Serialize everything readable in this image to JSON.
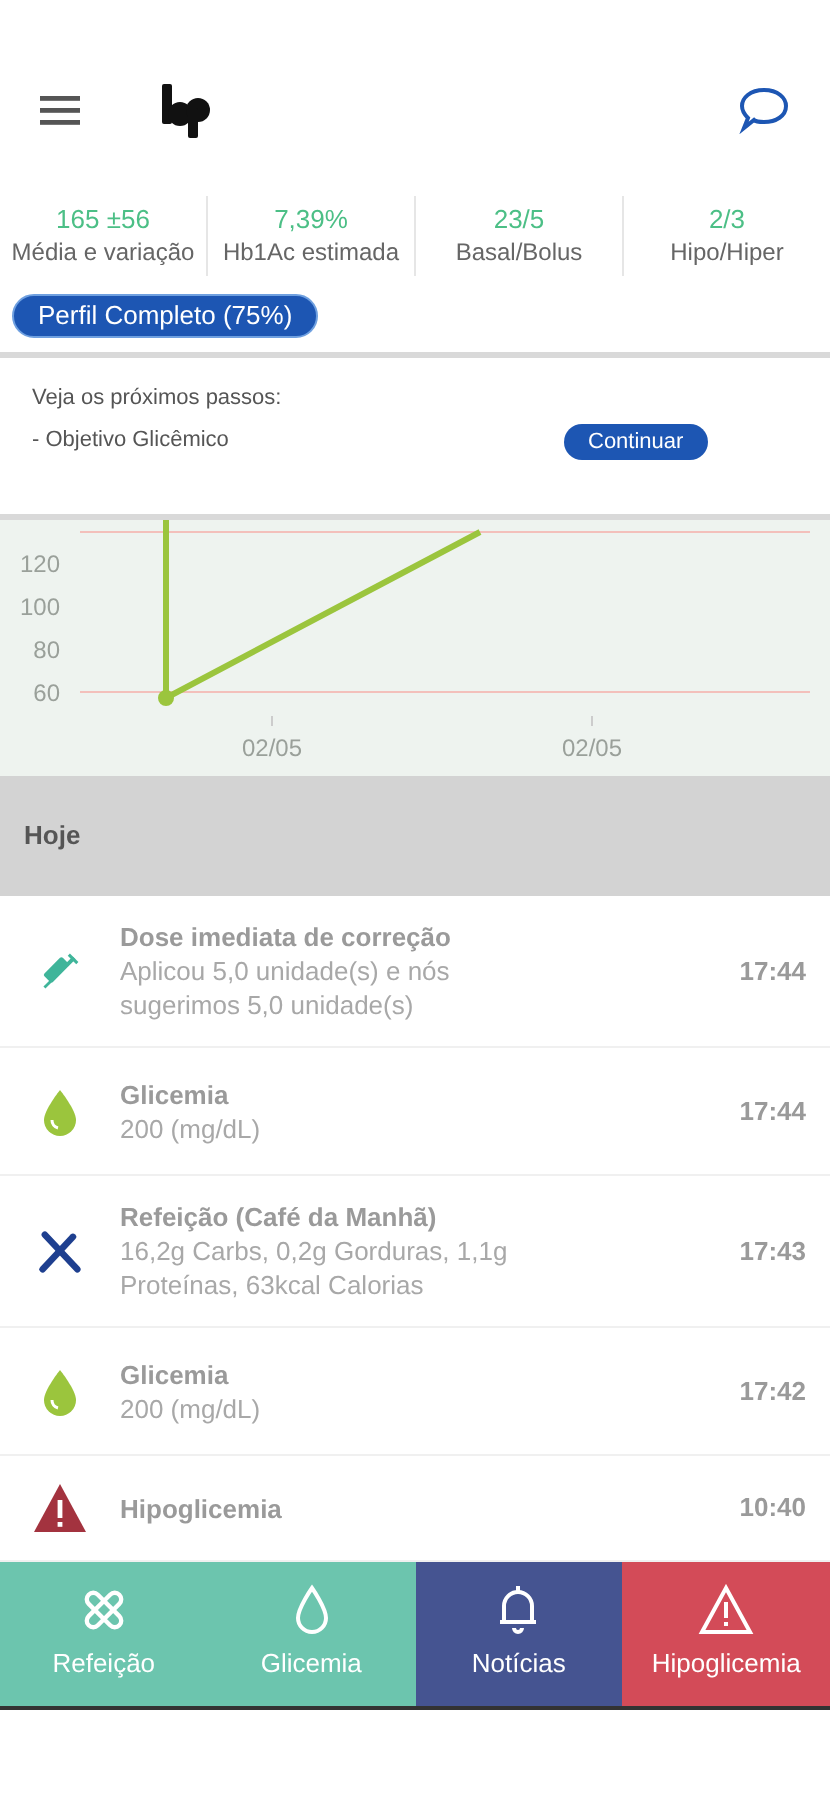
{
  "stats": [
    {
      "value": "165 ±56",
      "label": "Média e variação"
    },
    {
      "value": "7,39%",
      "label": "Hb1Ac estimada"
    },
    {
      "value": "23/5",
      "label": "Basal/Bolus"
    },
    {
      "value": "2/3",
      "label": "Hipo/Hiper"
    }
  ],
  "profile_badge": "Perfil Completo (75%)",
  "next_steps": {
    "title": "Veja os próximos passos:",
    "item": "- Objetivo Glicêmico",
    "button": "Continuar"
  },
  "glucose_graph": {
    "y_axis_labels": [
      "120",
      "100",
      "80",
      "60"
    ],
    "x_axis_labels": [
      "02/05",
      "02/05"
    ]
  },
  "section_title": "Hoje",
  "events": [
    {
      "kind": "dose",
      "title": "Dose imediata de correção",
      "detail": "Aplicou 5,0 unidade(s) e nós sugerimos 5,0 unidade(s)",
      "time": "17:44"
    },
    {
      "kind": "glucose",
      "title": "Glicemia",
      "detail": "200 (mg/dL)",
      "time": "17:44"
    },
    {
      "kind": "meal",
      "title": "Refeição (Café da Manhã)",
      "detail": "16,2g Carbs, 0,2g Gorduras, 1,1g Proteínas, 63kcal Calorias",
      "time": "17:43"
    },
    {
      "kind": "glucose",
      "title": "Glicemia",
      "detail": "200 (mg/dL)",
      "time": "17:42"
    },
    {
      "kind": "hypo",
      "title": "Hipoglicemia",
      "time": "10:40"
    }
  ],
  "bottom_actions": [
    {
      "kind": "meal",
      "label": "Refeição",
      "color": "#6cc5ae"
    },
    {
      "kind": "glucose",
      "label": "Glicemia",
      "color": "#6cc5ae"
    },
    {
      "kind": "news",
      "label": "Notícias",
      "color": "#455491"
    },
    {
      "kind": "hypo",
      "label": "Hipoglicemia",
      "color": "#d34b58"
    }
  ]
}
